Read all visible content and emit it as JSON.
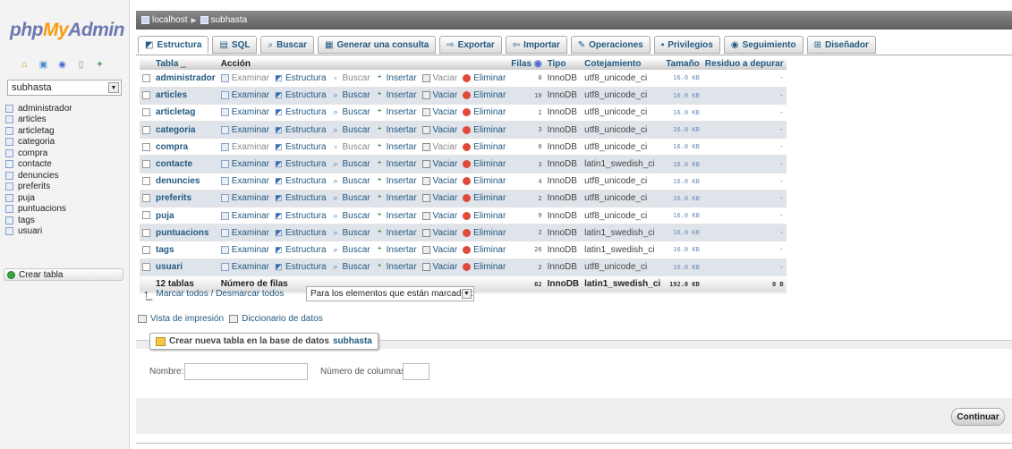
{
  "nav": {
    "logo_php": "php",
    "logo_my": "My",
    "logo_admin": "Admin",
    "icons": [
      "home-icon",
      "exit-icon",
      "help-icon",
      "docs-icon",
      "settings-icon"
    ],
    "db_selected": "subhasta",
    "tables": [
      "administrador",
      "articles",
      "articletag",
      "categoria",
      "compra",
      "contacte",
      "denuncies",
      "preferits",
      "puja",
      "puntuacions",
      "tags",
      "usuari"
    ],
    "create_table_label": "Crear tabla"
  },
  "breadcrumb": {
    "server": "localhost",
    "database": "subhasta"
  },
  "tabs": [
    {
      "label": "Estructura",
      "icon": "structure-icon"
    },
    {
      "label": "SQL",
      "icon": "sql-icon"
    },
    {
      "label": "Buscar",
      "icon": "search-icon"
    },
    {
      "label": "Generar una consulta",
      "icon": "query-icon"
    },
    {
      "label": "Exportar",
      "icon": "export-icon"
    },
    {
      "label": "Importar",
      "icon": "import-icon"
    },
    {
      "label": "Operaciones",
      "icon": "operations-icon"
    },
    {
      "label": "Privilegios",
      "icon": "privileges-icon"
    },
    {
      "label": "Seguimiento",
      "icon": "tracking-icon"
    },
    {
      "label": "Diseñador",
      "icon": "designer-icon"
    }
  ],
  "table": {
    "headers": {
      "tabla": "Tabla",
      "accion": "Acción",
      "filas": "Filas",
      "tipo": "Tipo",
      "cotejamiento": "Cotejamiento",
      "tamano": "Tamaño",
      "residuo": "Residuo a depurar"
    },
    "actions": {
      "examinar": "Examinar",
      "estructura": "Estructura",
      "buscar": "Buscar",
      "insertar": "Insertar",
      "vaciar": "Vaciar",
      "eliminar": "Eliminar"
    },
    "rows": [
      {
        "name": "administrador",
        "rows": "0",
        "engine": "InnoDB",
        "collation": "utf8_unicode_ci",
        "size": "16.0 KB",
        "overhead": "-",
        "empty": true
      },
      {
        "name": "articles",
        "rows": "10",
        "engine": "InnoDB",
        "collation": "utf8_unicode_ci",
        "size": "16.0 KB",
        "overhead": "-",
        "empty": false
      },
      {
        "name": "articletag",
        "rows": "1",
        "engine": "InnoDB",
        "collation": "utf8_unicode_ci",
        "size": "16.0 KB",
        "overhead": "-",
        "empty": false
      },
      {
        "name": "categoria",
        "rows": "3",
        "engine": "InnoDB",
        "collation": "utf8_unicode_ci",
        "size": "16.0 KB",
        "overhead": "-",
        "empty": false
      },
      {
        "name": "compra",
        "rows": "0",
        "engine": "InnoDB",
        "collation": "utf8_unicode_ci",
        "size": "16.0 KB",
        "overhead": "-",
        "empty": true
      },
      {
        "name": "contacte",
        "rows": "3",
        "engine": "InnoDB",
        "collation": "latin1_swedish_ci",
        "size": "16.0 KB",
        "overhead": "-",
        "empty": false
      },
      {
        "name": "denuncies",
        "rows": "4",
        "engine": "InnoDB",
        "collation": "utf8_unicode_ci",
        "size": "16.0 KB",
        "overhead": "-",
        "empty": false
      },
      {
        "name": "preferits",
        "rows": "2",
        "engine": "InnoDB",
        "collation": "utf8_unicode_ci",
        "size": "16.0 KB",
        "overhead": "-",
        "empty": false
      },
      {
        "name": "puja",
        "rows": "9",
        "engine": "InnoDB",
        "collation": "utf8_unicode_ci",
        "size": "16.0 KB",
        "overhead": "-",
        "empty": false
      },
      {
        "name": "puntuacions",
        "rows": "2",
        "engine": "InnoDB",
        "collation": "latin1_swedish_ci",
        "size": "16.0 KB",
        "overhead": "-",
        "empty": false
      },
      {
        "name": "tags",
        "rows": "26",
        "engine": "InnoDB",
        "collation": "latin1_swedish_ci",
        "size": "16.0 KB",
        "overhead": "-",
        "empty": false
      },
      {
        "name": "usuari",
        "rows": "2",
        "engine": "InnoDB",
        "collation": "utf8_unicode_ci",
        "size": "16.0 KB",
        "overhead": "-",
        "empty": false
      }
    ],
    "summary": {
      "tables": "12 tablas",
      "label": "Número de filas",
      "rows": "62",
      "engine": "InnoDB",
      "collation": "latin1_swedish_ci",
      "size": "192.0 KB",
      "overhead": "0 B"
    }
  },
  "bulk": {
    "check_all": "Marcar todos / Desmarcar todos",
    "with_selected": "Para los elementos que están marcados:"
  },
  "links": {
    "print": "Vista de impresión",
    "dictionary": "Diccionario de datos"
  },
  "create": {
    "legend_prefix": "Crear nueva tabla en la base de datos",
    "legend_db": "subhasta",
    "name_label": "Nombre:",
    "name_value": "",
    "cols_label": "Número de columnas:",
    "cols_value": "",
    "continue": "Continuar"
  },
  "colors": {
    "link": "#235a81",
    "logo_blue": "#6c78af",
    "logo_orange": "#f89c0e",
    "row_alt": "#dfe3ea",
    "delete_red": "#e04a3a"
  }
}
